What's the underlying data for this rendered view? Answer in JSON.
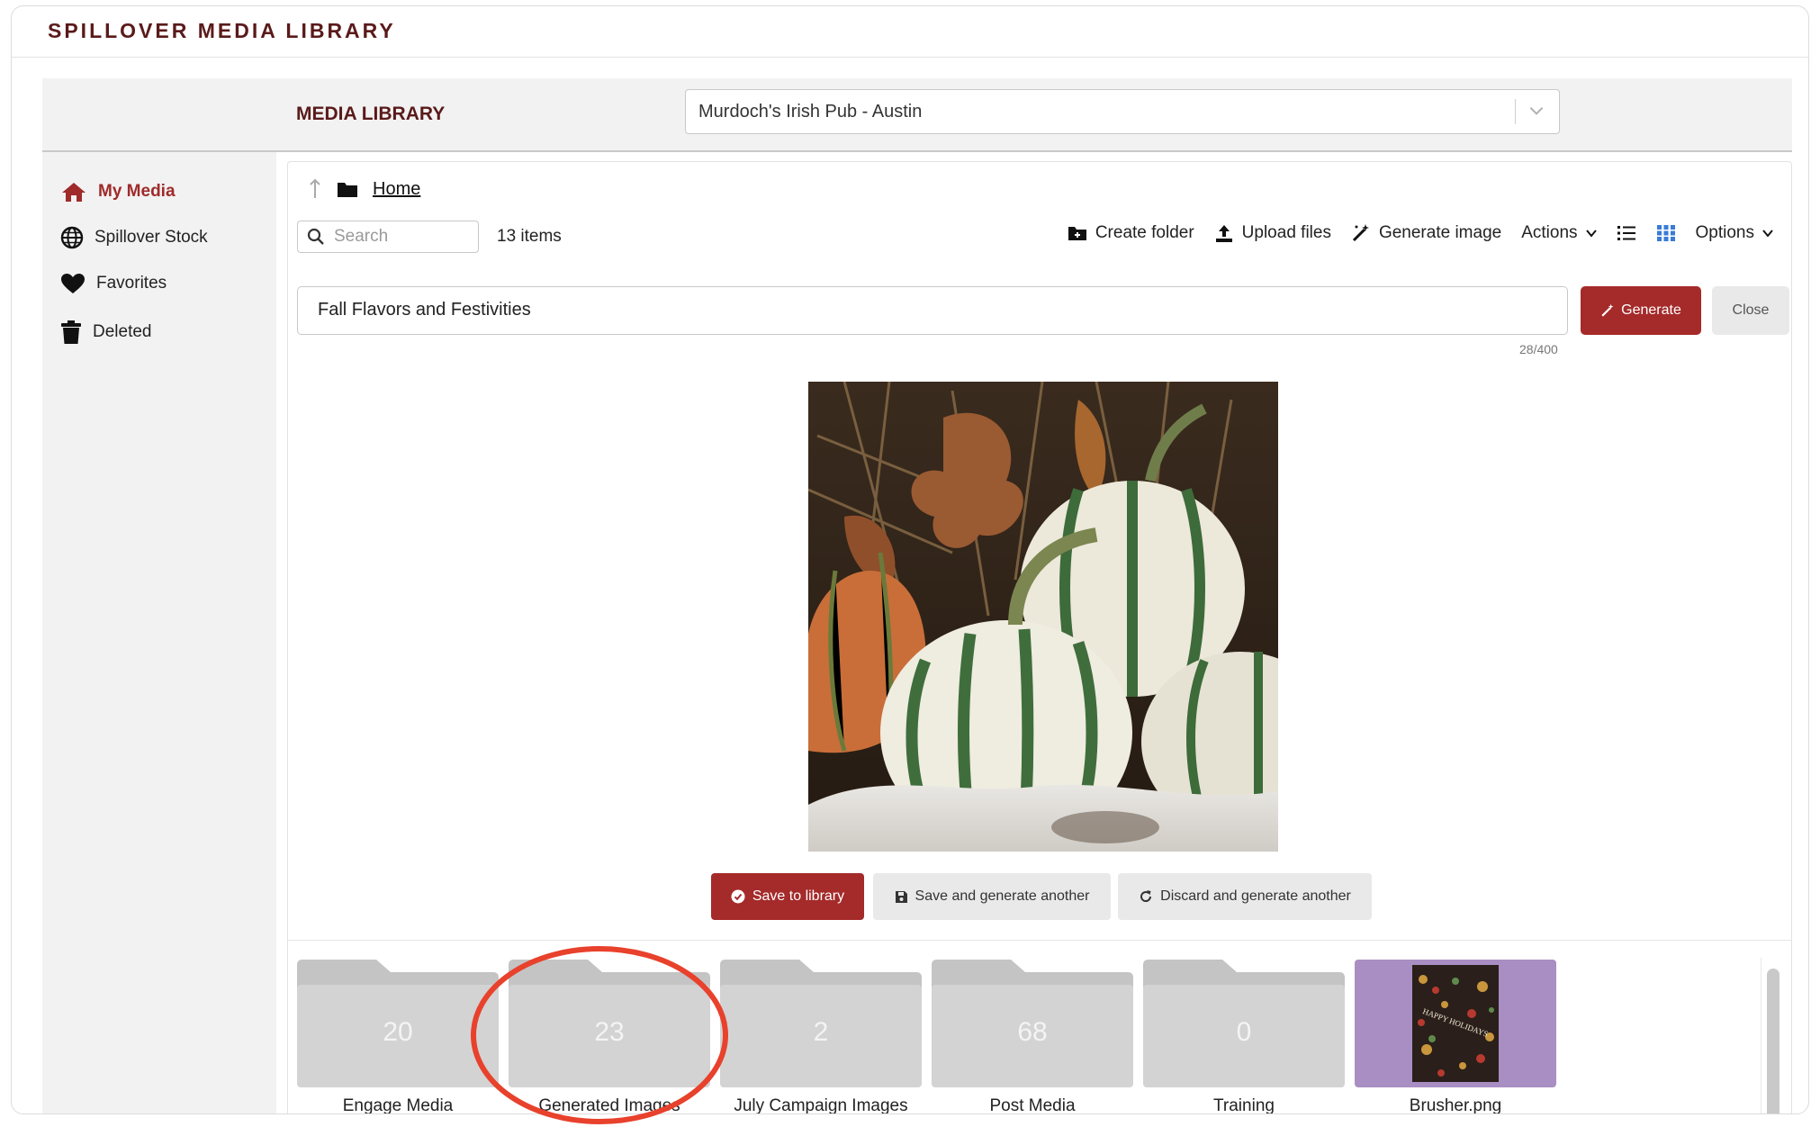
{
  "app": {
    "title": "SPILLOVER MEDIA LIBRARY"
  },
  "header": {
    "label": "MEDIA LIBRARY",
    "location_value": "Murdoch's Irish Pub - Austin"
  },
  "sidebar": {
    "items": [
      {
        "label": "My Media",
        "icon": "home-icon",
        "active": true
      },
      {
        "label": "Spillover Stock",
        "icon": "globe-icon"
      },
      {
        "label": "Favorites",
        "icon": "heart-icon"
      },
      {
        "label": "Deleted",
        "icon": "trash-icon"
      }
    ]
  },
  "breadcrumb": {
    "home_label": "Home"
  },
  "search": {
    "placeholder": "Search",
    "value": ""
  },
  "items_count": "13 items",
  "toolbar": {
    "create_folder": "Create folder",
    "upload_files": "Upload files",
    "generate_image": "Generate image",
    "actions": "Actions",
    "options": "Options"
  },
  "generator": {
    "prompt_value": "Fall Flavors and Festivities",
    "generate_label": "Generate",
    "close_label": "Close",
    "char_count": "28/400",
    "save_label": "Save to library",
    "save_generate_label": "Save and generate another",
    "discard_label": "Discard and generate another"
  },
  "tiles": [
    {
      "type": "folder",
      "count": "20",
      "name": "Engage Media"
    },
    {
      "type": "folder",
      "count": "23",
      "name": "Generated Images"
    },
    {
      "type": "folder",
      "count": "2",
      "name": "July Campaign Images"
    },
    {
      "type": "folder",
      "count": "68",
      "name": "Post Media"
    },
    {
      "type": "folder",
      "count": "0",
      "name": "Training"
    },
    {
      "type": "image",
      "name": "Brusher.png",
      "card_text": "HAPPY HOLIDAYS"
    }
  ],
  "colors": {
    "brand": "#5a1a1a",
    "accent": "#a52a2a",
    "highlight": "#e8412c",
    "tile_image_bg": "#a98ec3"
  }
}
